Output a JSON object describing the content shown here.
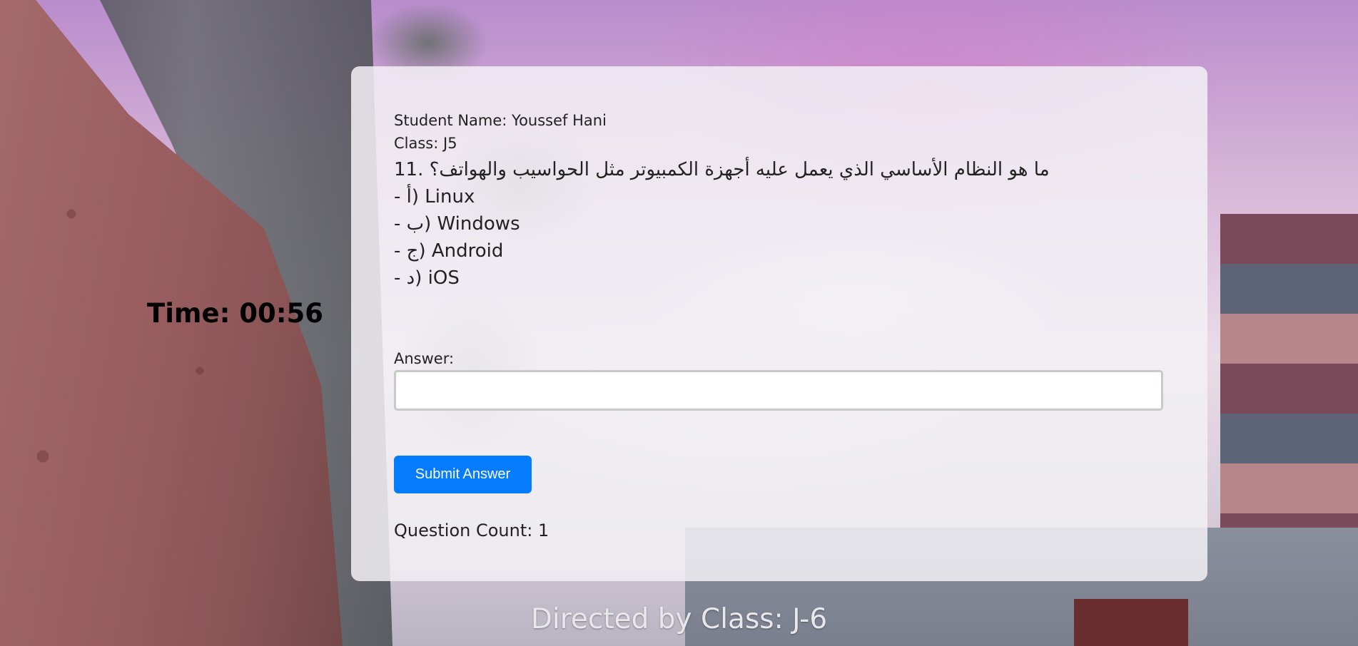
{
  "timer": {
    "label": "Time: 00:56"
  },
  "quiz": {
    "student_name": "Student Name: Youssef Hani",
    "class": "Class: J5",
    "question": "11. ما هو النظام الأساسي الذي يعمل عليه أجهزة الكمبيوتر مثل الحواسيب والهواتف؟",
    "options": [
      "- أ) Linux",
      "- ب) Windows",
      "- ج) Android",
      "- د) iOS"
    ],
    "answer_label": "Answer:",
    "answer_value": "",
    "answer_placeholder": "",
    "submit_label": "Submit Answer",
    "question_count": "Question Count: 1"
  },
  "footer": {
    "text": "Directed by Class: J-6"
  },
  "colors": {
    "primary_button": "#057bfe",
    "card_background": "#f2f0f4",
    "text": "#222222"
  }
}
